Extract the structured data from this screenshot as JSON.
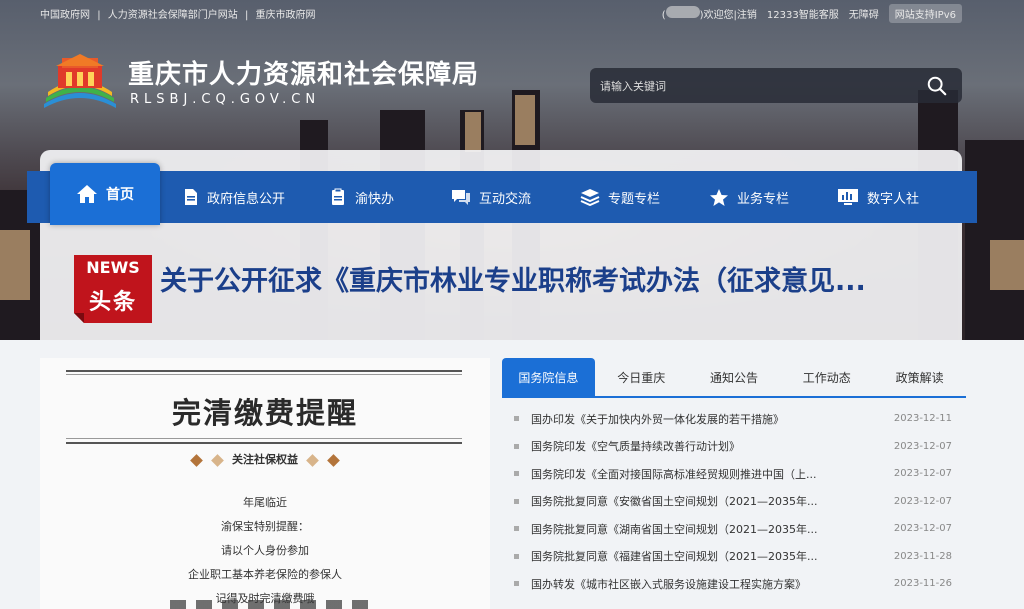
{
  "topbar": {
    "links": [
      "中国政府网",
      "|",
      "人力资源社会保障部门户网站",
      "|",
      "重庆市政府网"
    ],
    "welcome": "欢迎您",
    "logout": "注销",
    "service": "12333智能客服",
    "accessibility": "无障碍",
    "ipv6": "网站支持IPv6"
  },
  "header": {
    "title": "重庆市人力资源和社会保障局",
    "domain": "RLSBJ.CQ.GOV.CN",
    "search_placeholder": "请输入关键词"
  },
  "nav": {
    "home": "首页",
    "items": [
      "政府信息公开",
      "渝快办",
      "互动交流",
      "专题专栏",
      "业务专栏",
      "数字人社"
    ]
  },
  "headline": {
    "badge_top": "NEWS",
    "badge_bottom": "头条",
    "text": "关于公开征求《重庆市林业专业职称考试办法（征求意见..."
  },
  "notice": {
    "title": "完清缴费提醒",
    "subtitle": "关注社保权益",
    "lines": [
      "年尾临近",
      "渝保宝特别提醒：",
      "请以个人身份参加",
      "企业职工基本养老保险的参保人",
      "记得及时完清缴费哦"
    ]
  },
  "news": {
    "tabs": [
      "国务院信息",
      "今日重庆",
      "通知公告",
      "工作动态",
      "政策解读"
    ],
    "rows": [
      {
        "title": "国办印发《关于加快内外贸一体化发展的若干措施》",
        "date": "2023-12-11"
      },
      {
        "title": "国务院印发《空气质量持续改善行动计划》",
        "date": "2023-12-07"
      },
      {
        "title": "国务院印发《全面对接国际高标准经贸规则推进中国（上...",
        "date": "2023-12-07"
      },
      {
        "title": "国务院批复同意《安徽省国土空间规划（2021—2035年...",
        "date": "2023-12-07"
      },
      {
        "title": "国务院批复同意《湖南省国土空间规划（2021—2035年...",
        "date": "2023-12-07"
      },
      {
        "title": "国务院批复同意《福建省国土空间规划（2021—2035年...",
        "date": "2023-11-28"
      },
      {
        "title": "国办转发《城市社区嵌入式服务设施建设工程实施方案》",
        "date": "2023-11-26"
      }
    ]
  },
  "colors": {
    "nav_blue": "#1e5bb0",
    "active_blue": "#1b6fd6",
    "headline_blue": "#1b3f8a",
    "news_red": "#c0141c"
  }
}
